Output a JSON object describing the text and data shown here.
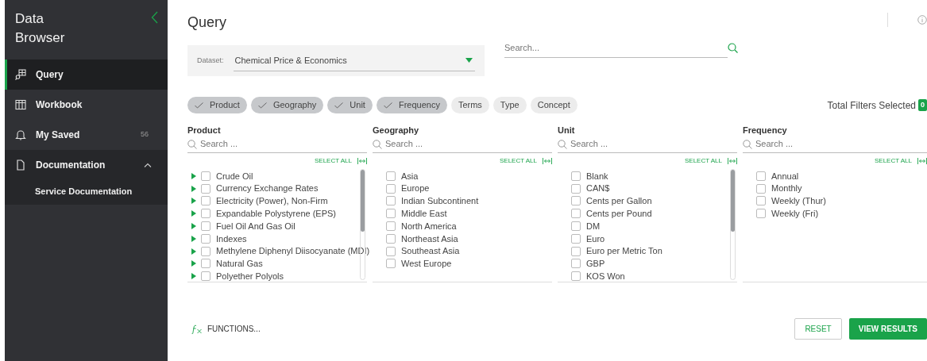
{
  "sidebar": {
    "title_lines": [
      "Data",
      "Browser"
    ],
    "items": [
      {
        "label": "Query",
        "selected": true,
        "expanded": false
      },
      {
        "label": "Workbook",
        "selected": false,
        "expanded": false
      },
      {
        "label": "My Saved",
        "count": "56",
        "selected": false,
        "expanded": false
      },
      {
        "label": "Documentation",
        "selected": false,
        "expanded": true,
        "children": [
          {
            "label": "Service Documentation"
          }
        ]
      }
    ]
  },
  "page_title": "Query",
  "dataset": {
    "label": "Dataset:",
    "value": "Chemical Price & Economics"
  },
  "search": {
    "placeholder": "Search..."
  },
  "filter_chips": [
    {
      "label": "Product",
      "selected": true
    },
    {
      "label": "Geography",
      "selected": true
    },
    {
      "label": "Unit",
      "selected": true
    },
    {
      "label": "Frequency",
      "selected": true
    },
    {
      "label": "Terms",
      "selected": false
    },
    {
      "label": "Type",
      "selected": false
    },
    {
      "label": "Concept",
      "selected": false
    }
  ],
  "total_filters": {
    "label": "Total Filters Selected",
    "count": "0"
  },
  "columns": [
    {
      "title": "Product",
      "placeholder": "Search ...",
      "select_all": "SELECT ALL",
      "scrollable": true,
      "items": [
        {
          "label": "Crude Oil",
          "expandable": true,
          "checked": false
        },
        {
          "label": "Currency Exchange Rates",
          "expandable": true,
          "checked": false
        },
        {
          "label": "Electricity (Power), Non-Firm",
          "expandable": true,
          "checked": false
        },
        {
          "label": "Expandable Polystyrene (EPS)",
          "expandable": true,
          "checked": false
        },
        {
          "label": "Fuel Oil And Gas Oil",
          "expandable": true,
          "checked": false
        },
        {
          "label": "Indexes",
          "expandable": true,
          "checked": false
        },
        {
          "label": "Methylene Diphenyl Diisocyanate (MDI)",
          "expandable": true,
          "checked": false
        },
        {
          "label": "Natural Gas",
          "expandable": true,
          "checked": false
        },
        {
          "label": "Polyether Polyols",
          "expandable": true,
          "checked": false
        }
      ]
    },
    {
      "title": "Geography",
      "placeholder": "Search ...",
      "select_all": "SELECT ALL",
      "scrollable": false,
      "items": [
        {
          "label": "Asia",
          "expandable": false,
          "checked": false
        },
        {
          "label": "Europe",
          "expandable": false,
          "checked": false
        },
        {
          "label": "Indian Subcontinent",
          "expandable": false,
          "checked": false
        },
        {
          "label": "Middle East",
          "expandable": false,
          "checked": false
        },
        {
          "label": "North America",
          "expandable": false,
          "checked": false
        },
        {
          "label": "Northeast Asia",
          "expandable": false,
          "checked": false
        },
        {
          "label": "Southeast Asia",
          "expandable": false,
          "checked": false
        },
        {
          "label": "West Europe",
          "expandable": false,
          "checked": false
        }
      ]
    },
    {
      "title": "Unit",
      "placeholder": "Search ...",
      "select_all": "SELECT ALL",
      "scrollable": true,
      "items": [
        {
          "label": "Blank",
          "expandable": false,
          "checked": false
        },
        {
          "label": "CAN$",
          "expandable": false,
          "checked": false
        },
        {
          "label": "Cents per Gallon",
          "expandable": false,
          "checked": false
        },
        {
          "label": "Cents per Pound",
          "expandable": false,
          "checked": false
        },
        {
          "label": "DM",
          "expandable": false,
          "checked": false
        },
        {
          "label": "Euro",
          "expandable": false,
          "checked": false
        },
        {
          "label": "Euro per Metric Ton",
          "expandable": false,
          "checked": false
        },
        {
          "label": "GBP",
          "expandable": false,
          "checked": false
        },
        {
          "label": "KOS Won",
          "expandable": false,
          "checked": false
        }
      ]
    },
    {
      "title": "Frequency",
      "placeholder": "Search ...",
      "select_all": "SELECT ALL",
      "scrollable": false,
      "items": [
        {
          "label": "Annual",
          "expandable": false,
          "checked": false
        },
        {
          "label": "Monthly",
          "expandable": false,
          "checked": false
        },
        {
          "label": "Weekly (Thur)",
          "expandable": false,
          "checked": false
        },
        {
          "label": "Weekly (Fri)",
          "expandable": false,
          "checked": false
        }
      ]
    }
  ],
  "functions_link": "FUNCTIONS...",
  "buttons": {
    "reset": "RESET",
    "view": "VIEW RESULTS"
  }
}
